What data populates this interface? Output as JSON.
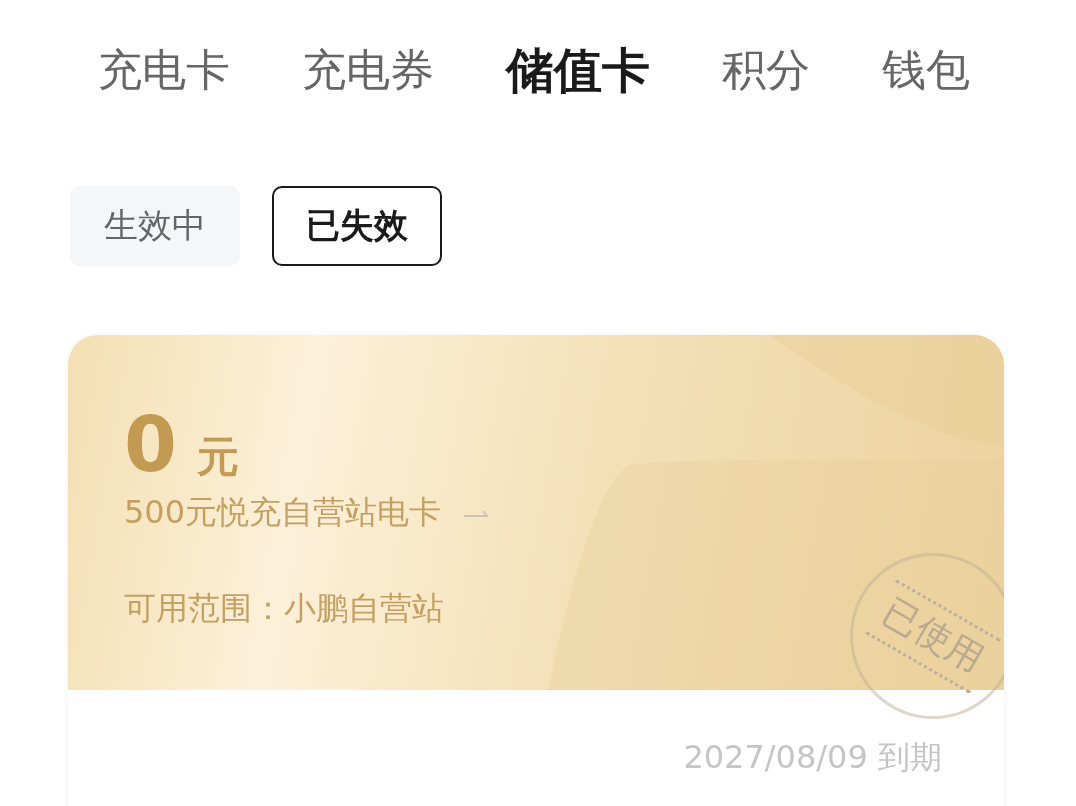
{
  "tabs": [
    {
      "label": "充电卡",
      "selected": false
    },
    {
      "label": "充电券",
      "selected": false
    },
    {
      "label": "储值卡",
      "selected": true
    },
    {
      "label": "积分",
      "selected": false
    },
    {
      "label": "钱包",
      "selected": false
    }
  ],
  "filters": [
    {
      "label": "生效中",
      "selected": false
    },
    {
      "label": "已失效",
      "selected": true
    }
  ],
  "cards": [
    {
      "amount": "0",
      "unit": "元",
      "name": "500元悦充自营站电卡",
      "scope": "可用范围：小鹏自营站",
      "stamp": "已使用",
      "expiry": "2027/08/09 到期"
    }
  ]
}
